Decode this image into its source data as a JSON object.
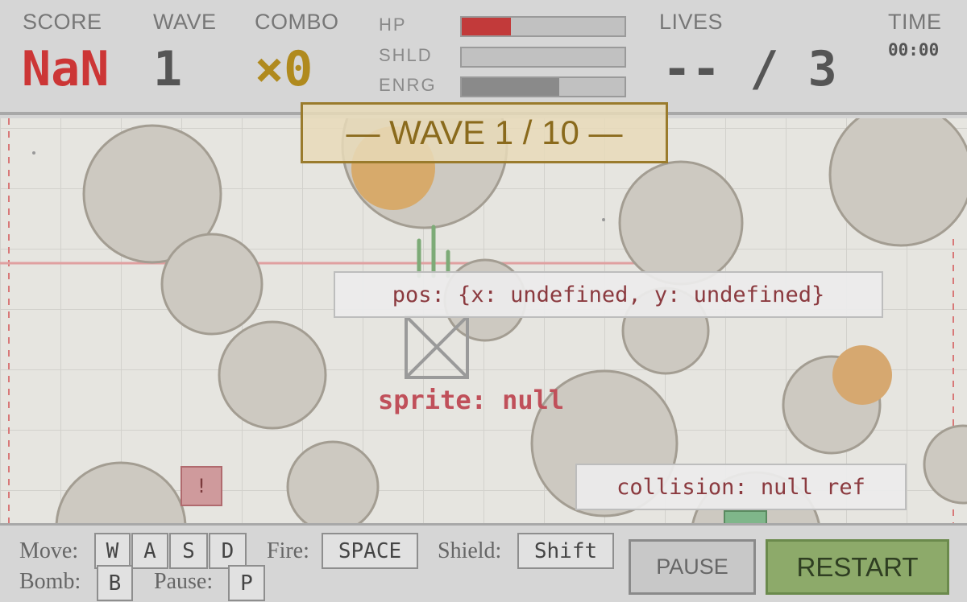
{
  "hud": {
    "score_label": "SCORE",
    "score_value": "NaN",
    "wave_label": "WAVE",
    "wave_value": "1",
    "combo_label": "COMBO",
    "combo_value": "×0",
    "hp_label": "HP",
    "hp_fraction": 0.3,
    "shield_label": "SHLD",
    "shield_fraction": 0,
    "energy_label": "ENRG",
    "energy_fraction": 0.6,
    "lives_label": "LIVES",
    "lives_value": "-- / 3",
    "time_label": "TIME",
    "time_value": "00:00"
  },
  "field": {
    "wave_banner": "— WAVE 1 / 10 —",
    "debug_pos": "pos: {x: undefined, y: undefined}",
    "debug_sprite": "sprite: null",
    "debug_collision": "collision: null ref",
    "warning_glyph": "!",
    "player_icon": "missing-sprite-icon"
  },
  "controls": {
    "move_label": "Move:",
    "move_keys": [
      "W",
      "A",
      "S",
      "D"
    ],
    "fire_label": "Fire:",
    "fire_key": "SPACE",
    "shield_label": "Shield:",
    "shield_key": "Shift",
    "bomb_label": "Bomb:",
    "bomb_key": "B",
    "pause_label": "Pause:",
    "pause_key": "P",
    "pause_button": "PAUSE",
    "restart_button": "RESTART"
  },
  "colors": {
    "score_red": "#cc3636",
    "combo_gold": "#b08a1e",
    "hp_red": "#c23a3a",
    "energy_gray": "#8a8a8a",
    "restart_green": "#8daa6a"
  }
}
